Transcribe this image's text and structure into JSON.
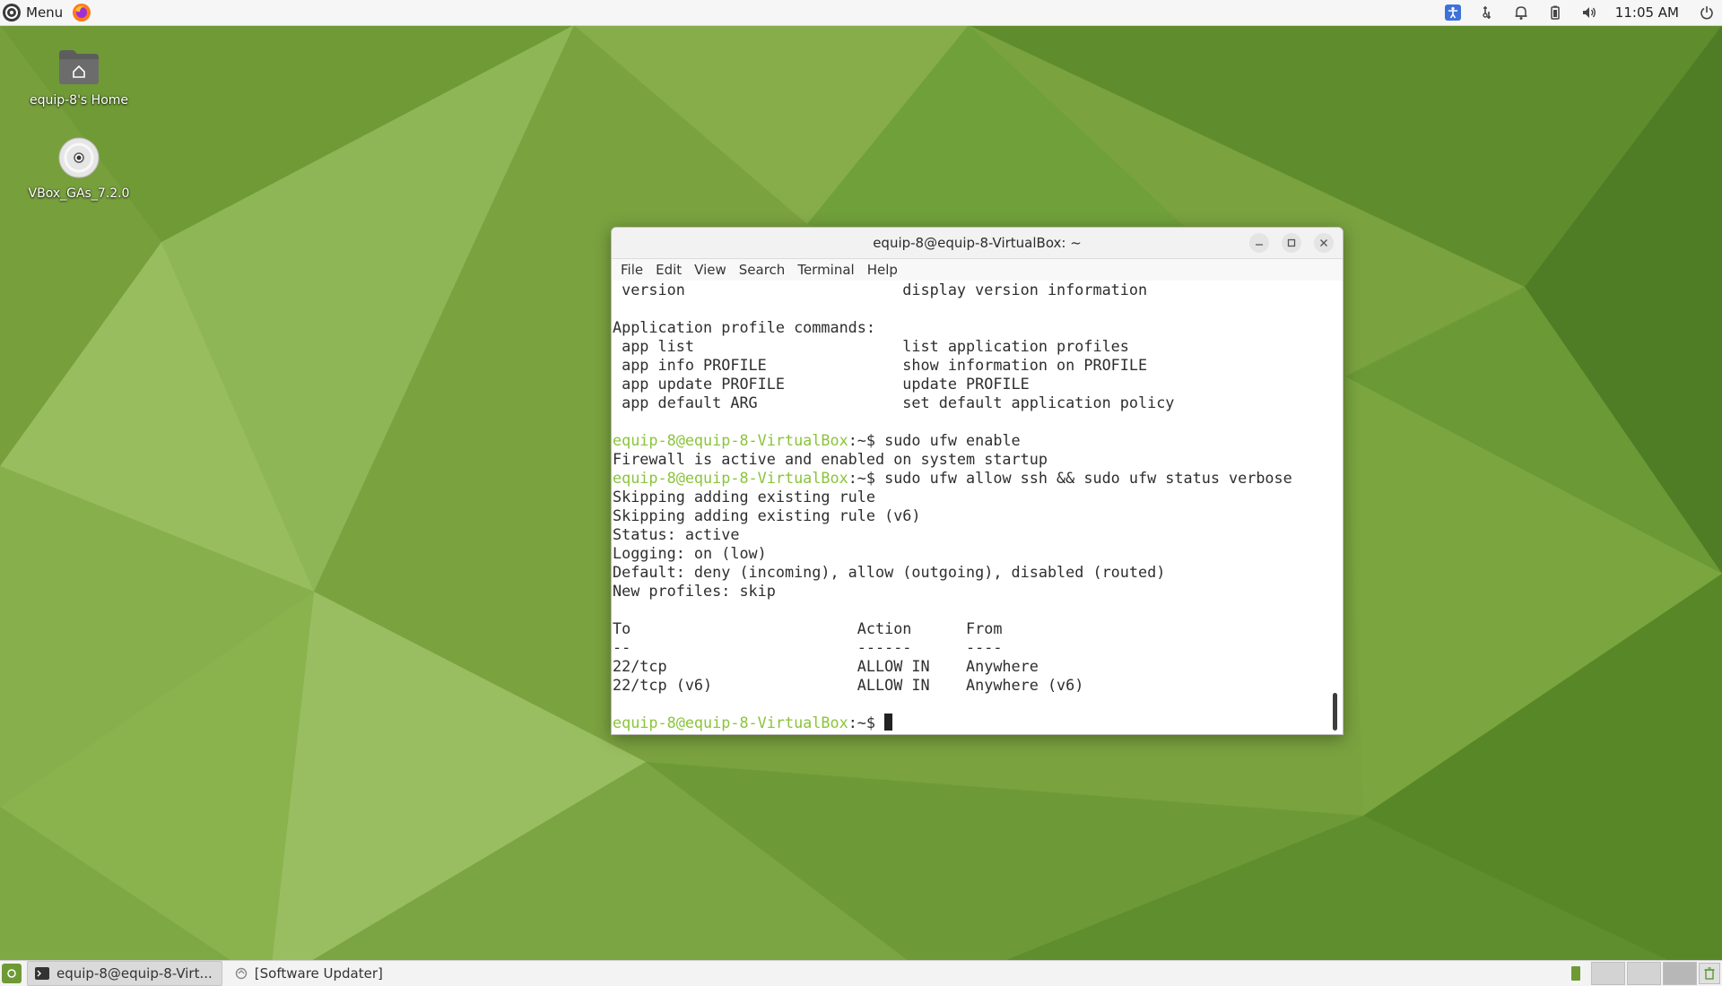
{
  "top_panel": {
    "menu_label": "Menu",
    "clock": "11:05 AM",
    "tray_icons": [
      "accessibility-icon",
      "network-icon",
      "notification-bell-icon",
      "battery-icon",
      "volume-icon",
      "power-icon"
    ],
    "accent_color": "#3d73d9"
  },
  "desktop": {
    "icons": [
      {
        "label": "equip-8's Home",
        "icon": "home-folder-icon"
      },
      {
        "label": "VBox_GAs_7.2.0",
        "icon": "optical-disc-icon"
      }
    ]
  },
  "terminal": {
    "title": "equip-8@equip-8-VirtualBox: ~",
    "menu": [
      "File",
      "Edit",
      "View",
      "Search",
      "Terminal",
      "Help"
    ],
    "lines": [
      [
        {
          "t": " version                        display version information"
        }
      ],
      [
        {
          "t": ""
        }
      ],
      [
        {
          "t": "Application profile commands:"
        }
      ],
      [
        {
          "t": " app list                       list application profiles"
        }
      ],
      [
        {
          "t": " app info PROFILE               show information on PROFILE"
        }
      ],
      [
        {
          "t": " app update PROFILE             update PROFILE"
        }
      ],
      [
        {
          "t": " app default ARG                set default application policy"
        }
      ],
      [
        {
          "t": ""
        }
      ],
      [
        {
          "t": "equip-8@equip-8-VirtualBox",
          "c": "prompt"
        },
        {
          "t": ":~$ sudo ufw enable"
        }
      ],
      [
        {
          "t": "Firewall is active and enabled on system startup"
        }
      ],
      [
        {
          "t": "equip-8@equip-8-VirtualBox",
          "c": "prompt"
        },
        {
          "t": ":~$ sudo ufw allow ssh && sudo ufw status verbose"
        }
      ],
      [
        {
          "t": "Skipping adding existing rule"
        }
      ],
      [
        {
          "t": "Skipping adding existing rule (v6)"
        }
      ],
      [
        {
          "t": "Status: active"
        }
      ],
      [
        {
          "t": "Logging: on (low)"
        }
      ],
      [
        {
          "t": "Default: deny (incoming), allow (outgoing), disabled (routed)"
        }
      ],
      [
        {
          "t": "New profiles: skip"
        }
      ],
      [
        {
          "t": ""
        }
      ],
      [
        {
          "t": "To                         Action      From"
        }
      ],
      [
        {
          "t": "--                         ------      ----"
        }
      ],
      [
        {
          "t": "22/tcp                     ALLOW IN    Anywhere"
        }
      ],
      [
        {
          "t": "22/tcp (v6)                ALLOW IN    Anywhere (v6)"
        }
      ],
      [
        {
          "t": ""
        }
      ],
      [
        {
          "t": "equip-8@equip-8-VirtualBox",
          "c": "prompt"
        },
        {
          "t": ":~$ "
        }
      ]
    ],
    "prompt_color": "#8ac43b"
  },
  "taskbar": {
    "tasks": [
      {
        "label": "equip-8@equip-8-Virt...",
        "icon": "terminal-icon",
        "active": true
      },
      {
        "label": "[Software Updater]",
        "icon": "software-updater-icon",
        "active": false
      }
    ]
  }
}
